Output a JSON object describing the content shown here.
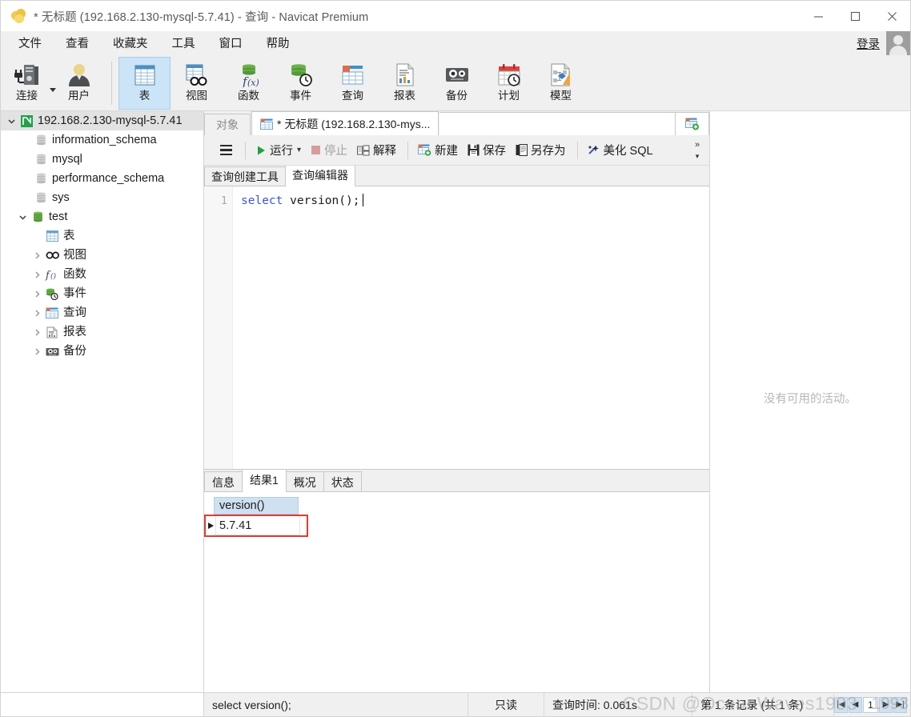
{
  "window": {
    "title": "* 无标题 (192.168.2.130-mysql-5.7.41) - 查询 - Navicat Premium",
    "app_icon": "navicat-logo-icon",
    "minimize": "minimize-icon",
    "maximize": "maximize-icon",
    "close": "close-icon"
  },
  "menubar": {
    "items": [
      {
        "label": "文件"
      },
      {
        "label": "查看"
      },
      {
        "label": "收藏夹"
      },
      {
        "label": "工具"
      },
      {
        "label": "窗口"
      },
      {
        "label": "帮助"
      }
    ],
    "login_label": "登录"
  },
  "toolbar": {
    "items": [
      {
        "label": "连接",
        "icon": "connection-icon",
        "selected": false,
        "has_dropdown": true
      },
      {
        "label": "用户",
        "icon": "user-icon",
        "selected": false,
        "has_dropdown": false
      },
      {
        "label": "表",
        "icon": "table-icon",
        "selected": true,
        "has_dropdown": false
      },
      {
        "label": "视图",
        "icon": "view-icon",
        "selected": false,
        "has_dropdown": false
      },
      {
        "label": "函数",
        "icon": "function-icon",
        "selected": false,
        "has_dropdown": false
      },
      {
        "label": "事件",
        "icon": "event-icon",
        "selected": false,
        "has_dropdown": false
      },
      {
        "label": "查询",
        "icon": "query-icon",
        "selected": false,
        "has_dropdown": false
      },
      {
        "label": "报表",
        "icon": "report-icon",
        "selected": false,
        "has_dropdown": false
      },
      {
        "label": "备份",
        "icon": "backup-icon",
        "selected": false,
        "has_dropdown": false
      },
      {
        "label": "计划",
        "icon": "schedule-icon",
        "selected": false,
        "has_dropdown": false
      },
      {
        "label": "模型",
        "icon": "model-icon",
        "selected": false,
        "has_dropdown": false
      }
    ]
  },
  "sidebar": {
    "root": {
      "label": "192.168.2.130-mysql-5.7.41",
      "icon": "navicat-connection-icon",
      "expanded": true
    },
    "databases": [
      {
        "label": "information_schema",
        "icon": "database-grey-icon",
        "expanded": false,
        "twisty": false
      },
      {
        "label": "mysql",
        "icon": "database-grey-icon",
        "expanded": false,
        "twisty": false
      },
      {
        "label": "performance_schema",
        "icon": "database-grey-icon",
        "expanded": false,
        "twisty": false
      },
      {
        "label": "sys",
        "icon": "database-grey-icon",
        "expanded": false,
        "twisty": false
      },
      {
        "label": "test",
        "icon": "database-green-icon",
        "expanded": true,
        "twisty": true
      }
    ],
    "test_children": [
      {
        "label": "表",
        "icon": "table-icon",
        "twisty": false
      },
      {
        "label": "视图",
        "icon": "view-icon",
        "twisty": true
      },
      {
        "label": "函数",
        "icon": "function-icon",
        "twisty": true
      },
      {
        "label": "事件",
        "icon": "event-icon",
        "twisty": true
      },
      {
        "label": "查询",
        "icon": "query-icon",
        "twisty": true
      },
      {
        "label": "报表",
        "icon": "report-icon",
        "twisty": true
      },
      {
        "label": "备份",
        "icon": "backup-icon",
        "twisty": true
      }
    ]
  },
  "object_tabs": {
    "tabs": [
      {
        "label": "对象",
        "active": false,
        "icon": null
      },
      {
        "label": "* 无标题 (192.168.2.130-mys...",
        "active": true,
        "icon": "query-tab-icon"
      }
    ],
    "add_tab_icon": "new-query-tab-icon"
  },
  "query_toolbar": {
    "menu_icon": "hamburger-menu-icon",
    "buttons": [
      {
        "label": "运行",
        "icon": "run-icon",
        "disabled": false,
        "has_dropdown": true
      },
      {
        "label": "停止",
        "icon": "stop-icon",
        "disabled": true,
        "has_dropdown": false
      },
      {
        "label": "解释",
        "icon": "explain-icon",
        "disabled": false,
        "has_dropdown": false
      },
      {
        "label": "新建",
        "icon": "new-icon",
        "disabled": false,
        "has_dropdown": false
      },
      {
        "label": "保存",
        "icon": "save-icon",
        "disabled": false,
        "has_dropdown": false
      },
      {
        "label": "另存为",
        "icon": "save-as-icon",
        "disabled": false,
        "has_dropdown": false
      },
      {
        "label": "美化 SQL",
        "icon": "beautify-sql-icon",
        "disabled": false,
        "has_dropdown": false
      }
    ],
    "overflow_label": "»"
  },
  "editor_tabs": [
    {
      "label": "查询创建工具",
      "active": false
    },
    {
      "label": "查询编辑器",
      "active": true
    }
  ],
  "editor": {
    "line_number": "1",
    "keyword": "select",
    "rest": " version();"
  },
  "result_tabs": [
    {
      "label": "信息",
      "active": false
    },
    {
      "label": "结果1",
      "active": true
    },
    {
      "label": "概况",
      "active": false
    },
    {
      "label": "状态",
      "active": false
    }
  ],
  "result_grid": {
    "columns": [
      "version()"
    ],
    "rows": [
      [
        "5.7.41"
      ]
    ],
    "selection_color": "#e03b33",
    "header_color": "#cfe0f0"
  },
  "grid_toolbar": {
    "buttons": [
      {
        "icon": "add-record-icon",
        "glyph": "+",
        "disabled": true
      },
      {
        "icon": "remove-record-icon",
        "glyph": "−",
        "disabled": true
      },
      {
        "icon": "apply-change-icon",
        "glyph": "✓",
        "disabled": true
      },
      {
        "icon": "cancel-change-icon",
        "glyph": "✗",
        "disabled": true
      },
      {
        "icon": "refresh-icon",
        "glyph": "⟳",
        "disabled": false
      },
      {
        "icon": "stop-loading-icon",
        "glyph": "⊘",
        "disabled": false
      }
    ],
    "view_modes": [
      {
        "icon": "grid-view-icon",
        "active": true
      },
      {
        "icon": "form-view-icon",
        "active": false
      }
    ]
  },
  "right_panel": {
    "empty_message": "没有可用的活动。"
  },
  "statusbar": {
    "sql": "select version();",
    "readonly": "只读",
    "query_time": "查询时间: 0.061s",
    "record_info": "第 1 条记录 (共 1 条)",
    "pager": {
      "first": "|◀",
      "prev": "◀",
      "page": "1",
      "next": "▶",
      "last": "▶|"
    }
  },
  "watermark": {
    "text": "CSDN @OceanWaves1993",
    "badge": "1993"
  }
}
